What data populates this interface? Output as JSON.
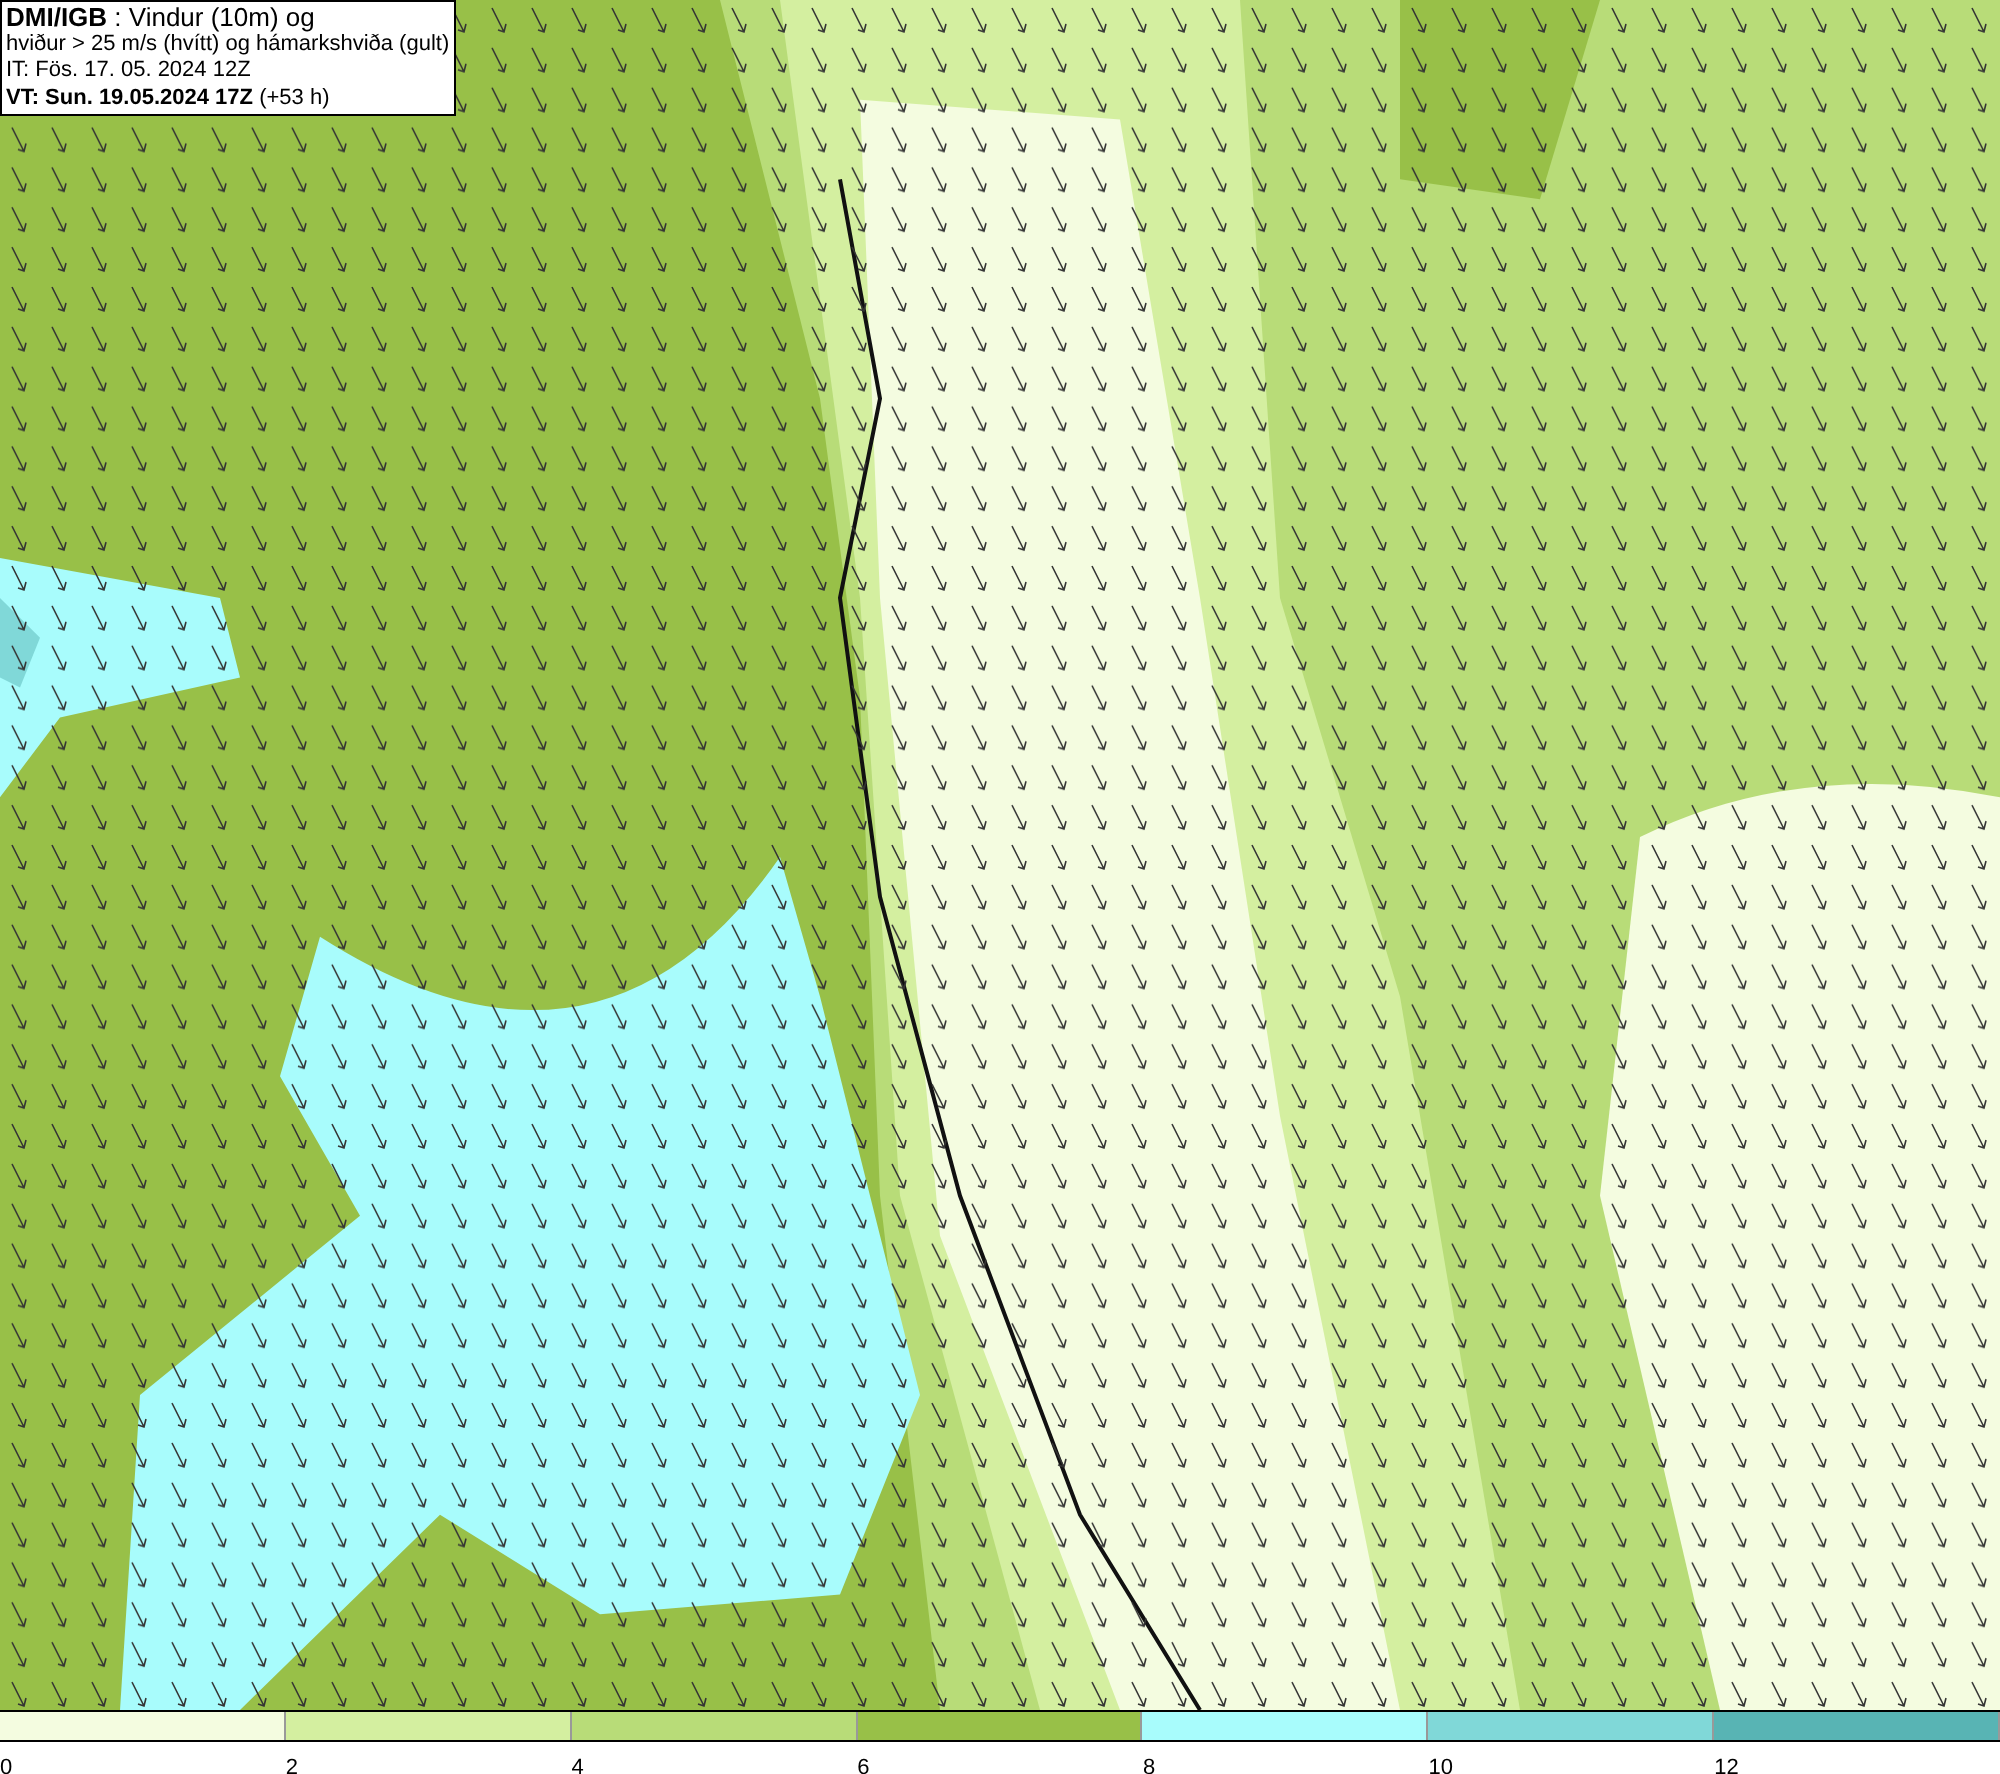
{
  "header": {
    "lines": [
      "**DMI/IGB** : Vindur (10m) og",
      "hviður > 25 m/s (hvítt) og hámarkshviða (gult)",
      "IT: Fös. 17. 05. 2024 12Z",
      "**VT: Sun. 19.05.2024 17Z** (+53 h)"
    ]
  },
  "legend": [
    {
      "label": "0",
      "color": "#f4fce0"
    },
    {
      "label": "2",
      "color": "#d4efa0"
    },
    {
      "label": "4",
      "color": "#b8dc78"
    },
    {
      "label": "6",
      "color": "#98c048"
    },
    {
      "label": "8",
      "color": "#a8fcfc"
    },
    {
      "label": "10",
      "color": "#80d8d8"
    },
    {
      "label": "12",
      "color": "#58b4b4"
    }
  ]
}
